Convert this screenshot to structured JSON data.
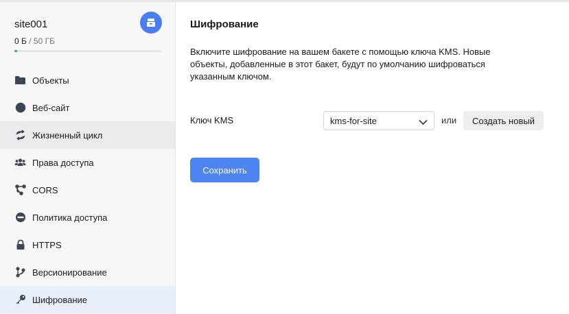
{
  "bucket": {
    "name": "site001",
    "used": "0 Б",
    "separator": "/",
    "total": "50 ГБ",
    "usage_fraction": 0.01,
    "icon": "bucket-icon"
  },
  "colors": {
    "accent": "#4e84f2",
    "progress": "#2cb542",
    "active_item_bg": "#e9effa"
  },
  "sidebar": {
    "items": [
      {
        "label": "Объекты",
        "icon": "folder-icon"
      },
      {
        "label": "Веб-сайт",
        "icon": "globe-icon"
      },
      {
        "label": "Жизненный цикл",
        "icon": "cycle-icon"
      },
      {
        "label": "Права доступа",
        "icon": "users-icon"
      },
      {
        "label": "CORS",
        "icon": "cors-icon"
      },
      {
        "label": "Политика доступа",
        "icon": "minus-circle-icon"
      },
      {
        "label": "HTTPS",
        "icon": "lock-icon"
      },
      {
        "label": "Версионирование",
        "icon": "branch-icon"
      },
      {
        "label": "Шифрование",
        "icon": "key-icon"
      }
    ]
  },
  "main": {
    "title": "Шифрование",
    "description": "Включите шифрование на вашем бакете с помощью ключа KMS. Новые объекты, добавленные в этот бакет, будут по умолчанию шифроваться указанным ключом.",
    "kms_label": "Ключ KMS",
    "kms_selected": "kms-for-site",
    "or_text": "или",
    "create_label": "Создать новый",
    "save_label": "Сохранить"
  }
}
